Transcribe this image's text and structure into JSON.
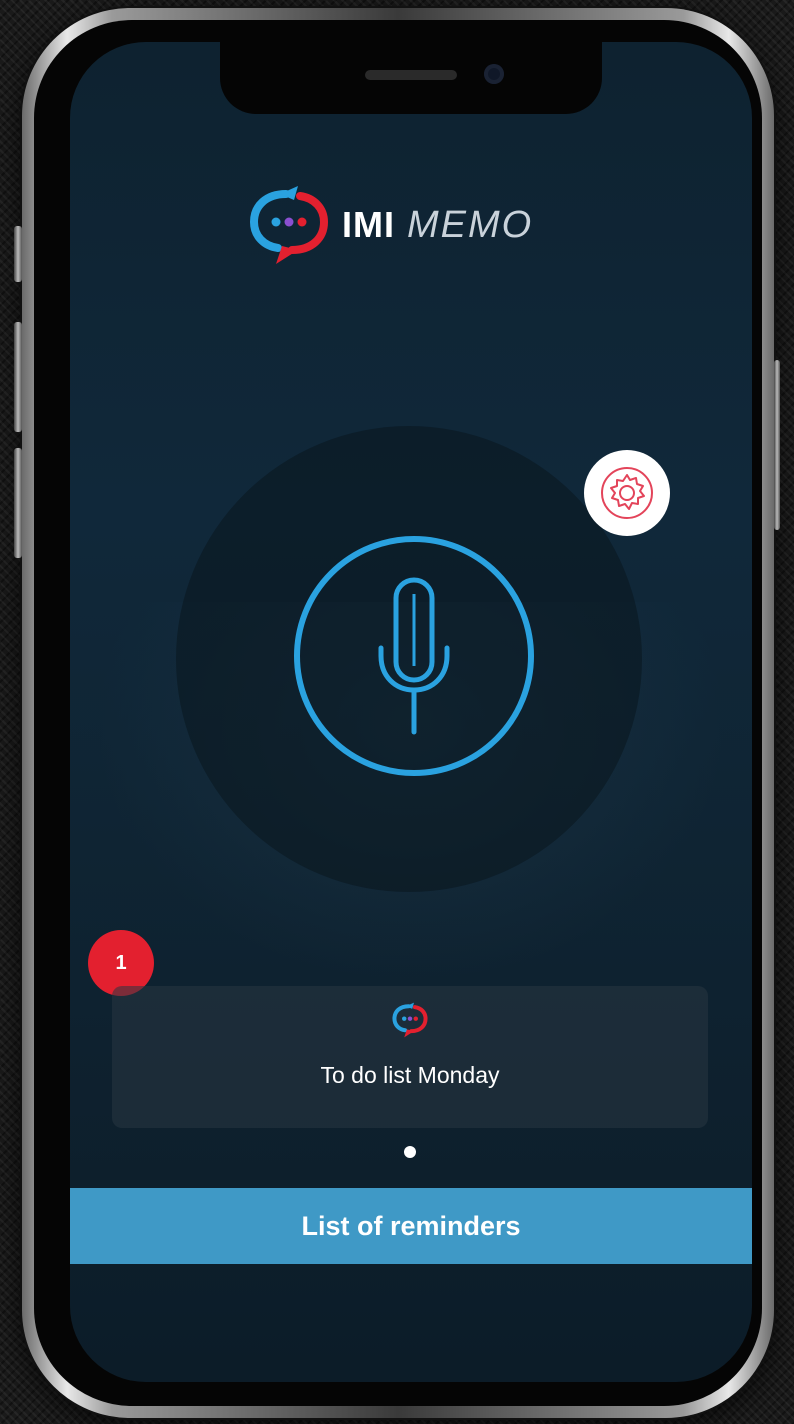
{
  "app": {
    "brand_bold": "IMI",
    "brand_light": "MEMO"
  },
  "icons": {
    "logo": "imi-chat-logo-icon",
    "mic": "microphone-icon",
    "settings": "gear-icon",
    "memo": "imi-chat-logo-icon"
  },
  "notification_badge": {
    "count": "1"
  },
  "memo_card": {
    "title": "To do list Monday"
  },
  "pager": {
    "total_pages": 1,
    "active_page": 1
  },
  "footer": {
    "button_label": "List of reminders"
  },
  "colors": {
    "accent_blue": "#2aa2e0",
    "accent_red": "#e3202f",
    "button_blue": "#3f99c6",
    "background": "#0f2433"
  }
}
